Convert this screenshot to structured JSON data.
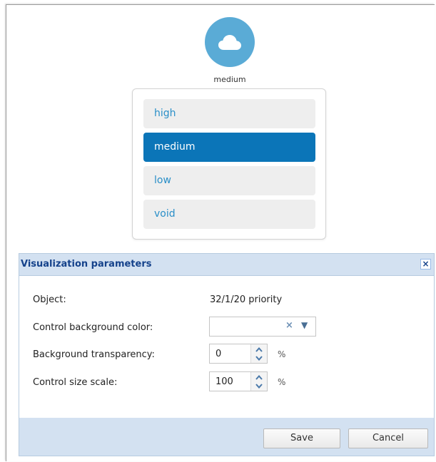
{
  "preview": {
    "icon": "cloud-icon",
    "label": "medium",
    "accent_color": "#5aabd6"
  },
  "priority_options": [
    {
      "label": "high",
      "selected": false
    },
    {
      "label": "medium",
      "selected": true
    },
    {
      "label": "low",
      "selected": false
    },
    {
      "label": "void",
      "selected": false
    }
  ],
  "dialog": {
    "title": "Visualization parameters",
    "close_icon": "close-icon",
    "fields": {
      "object": {
        "label": "Object:",
        "value": "32/1/20 priority"
      },
      "background_color": {
        "label": "Control background color:",
        "value": ""
      },
      "transparency": {
        "label": "Background transparency:",
        "value": "0",
        "unit": "%"
      },
      "size_scale": {
        "label": "Control size scale:",
        "value": "100",
        "unit": "%"
      }
    },
    "buttons": {
      "save": "Save",
      "cancel": "Cancel"
    }
  },
  "colors": {
    "selected_option": "#0b75b8",
    "option_text": "#2a8fc8",
    "dialog_header": "#d3e1f1",
    "dialog_title": "#15428b"
  }
}
